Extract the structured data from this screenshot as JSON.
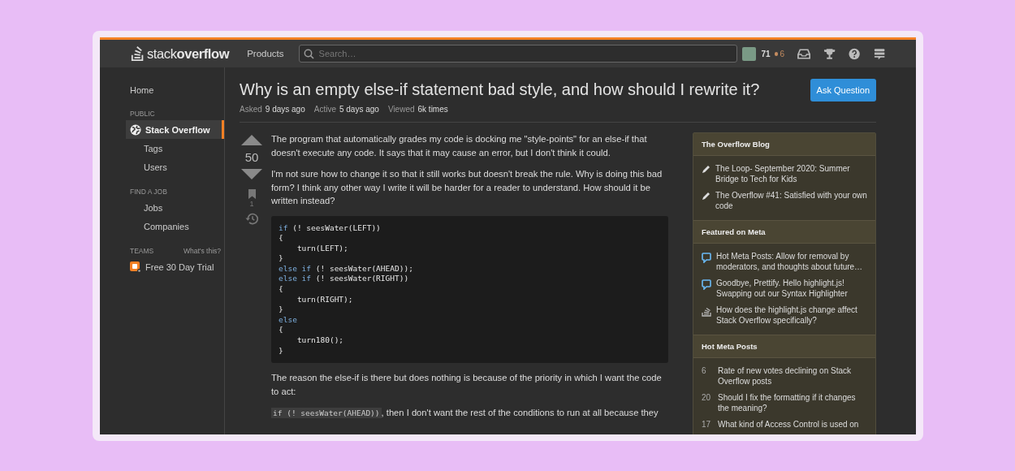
{
  "topbar": {
    "logo": "stack**overflow**",
    "products": "Products",
    "search": {
      "placeholder": "Search…"
    },
    "reputation": "71",
    "bronze_badges": "6"
  },
  "sidebar": {
    "home": "Home",
    "sections": [
      {
        "heading": "PUBLIC",
        "items": [
          {
            "label": "Stack Overflow",
            "selected": true,
            "kind": "globe"
          },
          {
            "label": "Tags",
            "selected": false,
            "kind": "plain"
          },
          {
            "label": "Users",
            "selected": false,
            "kind": "plain"
          }
        ]
      },
      {
        "heading": "FIND A JOB",
        "items": [
          {
            "label": "Jobs",
            "selected": false,
            "kind": "plain"
          },
          {
            "label": "Companies",
            "selected": false,
            "kind": "plain"
          }
        ]
      },
      {
        "heading": "TEAMS",
        "aside": "What's this?",
        "items": [
          {
            "label": "Free 30 Day Trial",
            "selected": false,
            "kind": "teams"
          }
        ]
      }
    ]
  },
  "question": {
    "title": "Why is an empty else-if statement bad style, and how should I rewrite it?",
    "ask_button": "Ask Question",
    "meta": [
      {
        "label": "Asked",
        "value": "9 days ago"
      },
      {
        "label": "Active",
        "value": "5 days ago"
      },
      {
        "label": "Viewed",
        "value": "6k times"
      }
    ],
    "votes": "50",
    "bookmarks": "1",
    "paragraphs": [
      "The program that automatically grades my code is docking me \"style-points\" for an else-if that doesn't execute any code. It says that it may cause an error, but I don't think it could.",
      "I'm not sure how to change it so that it still works but doesn't break the rule. Why is doing this bad form? I think any other way I write it will be harder for a reader to understand. How should it be written instead?"
    ],
    "code": [
      [
        {
          "kind": "keyword",
          "text": "if"
        },
        {
          "kind": "plain",
          "text": " (! seesWater(LEFT))"
        }
      ],
      [
        {
          "kind": "plain",
          "text": "{"
        }
      ],
      [
        {
          "kind": "plain",
          "text": "    turn(LEFT);"
        }
      ],
      [
        {
          "kind": "plain",
          "text": "}"
        }
      ],
      [
        {
          "kind": "keyword",
          "text": "else if"
        },
        {
          "kind": "plain",
          "text": " (! seesWater(AHEAD));"
        }
      ],
      [
        {
          "kind": "keyword",
          "text": "else if"
        },
        {
          "kind": "plain",
          "text": " (! seesWater(RIGHT))"
        }
      ],
      [
        {
          "kind": "plain",
          "text": "{"
        }
      ],
      [
        {
          "kind": "plain",
          "text": "    turn(RIGHT);"
        }
      ],
      [
        {
          "kind": "plain",
          "text": "}"
        }
      ],
      [
        {
          "kind": "keyword",
          "text": "else"
        }
      ],
      [
        {
          "kind": "plain",
          "text": "{"
        }
      ],
      [
        {
          "kind": "plain",
          "text": "    turn180();"
        }
      ],
      [
        {
          "kind": "plain",
          "text": "}"
        }
      ]
    ],
    "after_code": "The reason the else-if is there but does nothing is because of the priority in which I want the code to act:",
    "last_paragraph": {
      "code": "if (! seesWater(AHEAD))",
      "text": ", then I don't want the rest of the conditions to run at all because they"
    }
  },
  "widgets": [
    {
      "heading": "The Overflow Blog",
      "items": [
        {
          "kind": "pencil",
          "text": "The Loop- September 2020: Summer Bridge to Tech for Kids"
        },
        {
          "kind": "pencil",
          "text": "The Overflow #41: Satisfied with your own code"
        }
      ]
    },
    {
      "heading": "Featured on Meta",
      "items": [
        {
          "kind": "chat",
          "text": "Hot Meta Posts: Allow for removal by moderators, and thoughts about future…"
        },
        {
          "kind": "chat",
          "text": "Goodbye, Prettify. Hello highlight.js! Swapping out our Syntax Highlighter"
        },
        {
          "kind": "stack",
          "text": "How does the highlight.js change affect Stack Overflow specifically?"
        }
      ]
    },
    {
      "heading": "Hot Meta Posts",
      "items": [
        {
          "kind": "count",
          "count": "6",
          "text": "Rate of new votes declining on Stack Overflow posts"
        },
        {
          "kind": "count",
          "count": "20",
          "text": "Should I fix the formatting if it changes the meaning?"
        },
        {
          "kind": "count",
          "count": "17",
          "text": "What kind of Access Control is used on"
        }
      ]
    }
  ]
}
